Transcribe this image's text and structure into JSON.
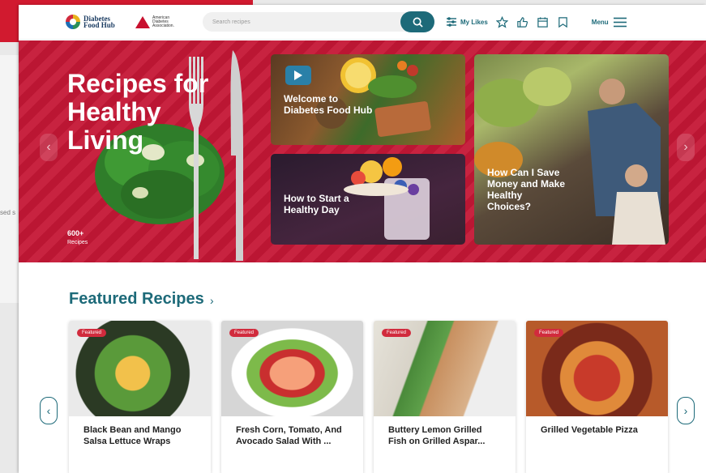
{
  "background": {
    "snippet": "sed s"
  },
  "header": {
    "logo_dfh": "Diabetes Food Hub",
    "logo_ada": "American Diabetes Association.",
    "search_placeholder": "Search recipes",
    "my_likes": "My Likes",
    "menu": "Menu"
  },
  "hero": {
    "title": "Recipes for Healthy Living",
    "count_value": "600+",
    "count_label": "Recipes",
    "tiles": [
      {
        "label": "Welcome to Diabetes Food Hub"
      },
      {
        "label": "How to Start a Healthy Day"
      },
      {
        "label": "How Can I Save Money and Make Healthy Choices?"
      }
    ]
  },
  "featured": {
    "title": "Featured Recipes",
    "badge": "Featured",
    "cards": [
      {
        "title": "Black Bean and Mango Salsa Lettuce Wraps"
      },
      {
        "title": "Fresh Corn, Tomato, And Avocado Salad With ..."
      },
      {
        "title": "Buttery Lemon Grilled Fish on Grilled Aspar..."
      },
      {
        "title": "Grilled Vegetable Pizza"
      }
    ]
  },
  "colors": {
    "brand_teal": "#1d6a79",
    "brand_red": "#c51736"
  }
}
